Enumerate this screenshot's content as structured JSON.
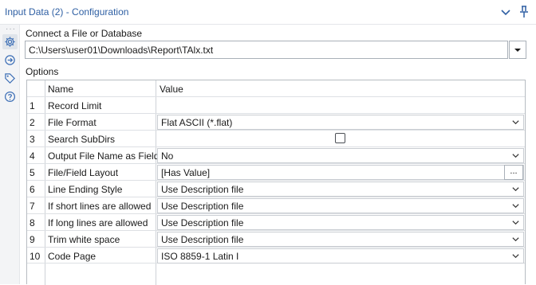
{
  "window": {
    "title": "Input Data (2) - Configuration",
    "icons": [
      "chevron-down-icon",
      "pin-icon"
    ]
  },
  "sidebar": {
    "items": [
      {
        "name": "configuration",
        "icon": "gear-icon",
        "active": true
      },
      {
        "name": "annotation",
        "icon": "arrow-circle-icon",
        "active": false
      },
      {
        "name": "tags",
        "icon": "tag-icon",
        "active": false
      },
      {
        "name": "help",
        "icon": "question-icon",
        "active": false
      }
    ]
  },
  "connect": {
    "label": "Connect a File or Database",
    "path": "C:\\Users\\user01\\Downloads\\Report\\TAlx.txt"
  },
  "options": {
    "label": "Options",
    "headers": {
      "name": "Name",
      "value": "Value"
    },
    "rows": [
      {
        "num": "1",
        "name": "Record Limit",
        "value": "",
        "control": "text"
      },
      {
        "num": "2",
        "name": "File Format",
        "value": "Flat ASCII (*.flat)",
        "control": "dropdown"
      },
      {
        "num": "3",
        "name": "Search SubDirs",
        "value": "",
        "control": "checkbox",
        "checked": false
      },
      {
        "num": "4",
        "name": "Output File Name as Field",
        "value": "No",
        "control": "dropdown"
      },
      {
        "num": "5",
        "name": "File/Field Layout",
        "value": "[Has Value]",
        "control": "ellipsis",
        "button": "..."
      },
      {
        "num": "6",
        "name": "Line Ending Style",
        "value": "Use Description file",
        "control": "dropdown"
      },
      {
        "num": "7",
        "name": "If short lines are allowed",
        "value": "Use Description file",
        "control": "dropdown"
      },
      {
        "num": "8",
        "name": "If long lines are allowed",
        "value": "Use Description file",
        "control": "dropdown"
      },
      {
        "num": "9",
        "name": "Trim white space",
        "value": "Use Description file",
        "control": "dropdown"
      },
      {
        "num": "10",
        "name": "Code Page",
        "value": "ISO 8859-1 Latin I",
        "control": "dropdown"
      }
    ]
  },
  "colors": {
    "title": "#2e5fa3",
    "sidebar_bg": "#f3f4f6",
    "icon": "#3d6fb6"
  }
}
